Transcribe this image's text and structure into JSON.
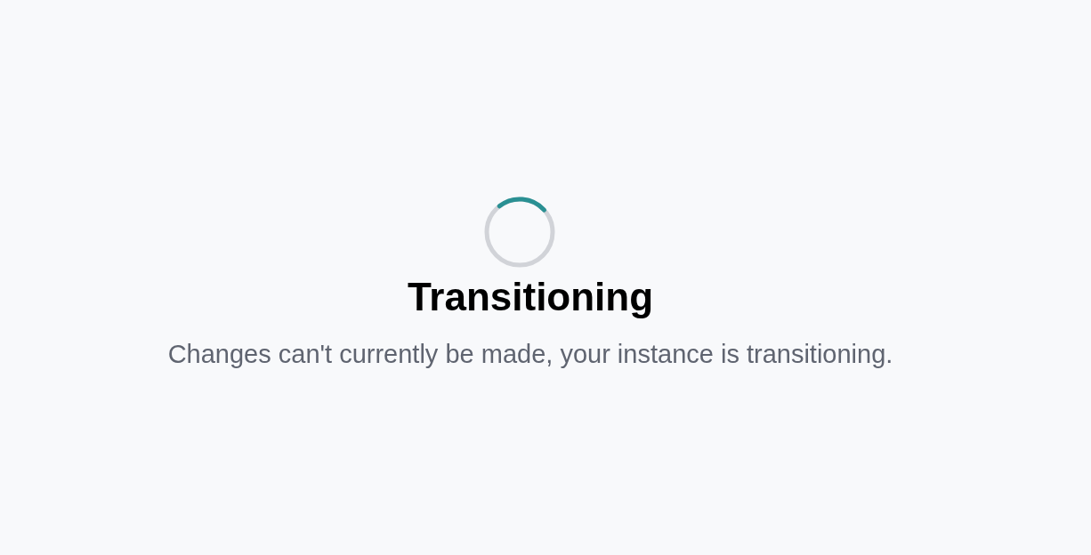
{
  "title": "Transitioning",
  "message": "Changes can't currently be made, your instance is transitioning."
}
